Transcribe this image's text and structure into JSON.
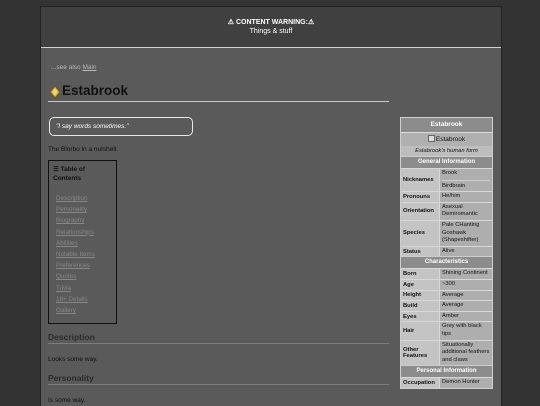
{
  "warning": {
    "title": "⚠ CONTENT WARNING:⚠",
    "subtitle": "Things & stuff"
  },
  "see_also": {
    "prefix": "...see also",
    "link": "Main"
  },
  "page_title": "Estabrook",
  "quote": "\"I say words sometimes.\"",
  "intro": "The Blorbo in a nutshell.",
  "toc": {
    "heading": "☰ Table of Contents",
    "items": [
      "Description",
      "Personality",
      "Biography",
      "Relationships",
      "Abilities",
      "Notable Items",
      "Preferences",
      "Quotes",
      "Trivia",
      "18+ Details",
      "Gallery"
    ]
  },
  "sections": [
    {
      "title": "Description",
      "text": "Looks some way."
    },
    {
      "title": "Personality",
      "text": "Is some way."
    }
  ],
  "infobox": {
    "title": "Estabrook",
    "image_alt": "Estabrook",
    "caption": "Estabrook's human form",
    "groups": [
      {
        "heading": "General Information",
        "rows": [
          {
            "key": "Nicknames",
            "values": [
              "Brook",
              "Birdbrain"
            ]
          },
          {
            "key": "Pronouns",
            "values": [
              "He/him"
            ]
          },
          {
            "key": "Orientation",
            "values": [
              "Asexual Demiromantic"
            ]
          },
          {
            "key": "Species",
            "values": [
              "Pale CHanting Goshawk (Shapeshifter)"
            ]
          },
          {
            "key": "Status",
            "values": [
              "Alive"
            ]
          }
        ]
      },
      {
        "heading": "Characteristics",
        "rows": [
          {
            "key": "Born",
            "values": [
              "Shining Continent"
            ]
          },
          {
            "key": "Age",
            "values": [
              "~300"
            ]
          },
          {
            "key": "Height",
            "values": [
              "Average"
            ]
          },
          {
            "key": "Build",
            "values": [
              "Average"
            ]
          },
          {
            "key": "Eyes",
            "values": [
              "Amber"
            ]
          },
          {
            "key": "Hair",
            "values": [
              "Grey with black tips"
            ]
          },
          {
            "key": "Other Features",
            "values": [
              "Situationally additional feathers and claws"
            ]
          }
        ]
      },
      {
        "heading": "Personal Information",
        "rows": [
          {
            "key": "Occupation",
            "values": [
              "Demon Hunter"
            ]
          }
        ]
      }
    ]
  }
}
